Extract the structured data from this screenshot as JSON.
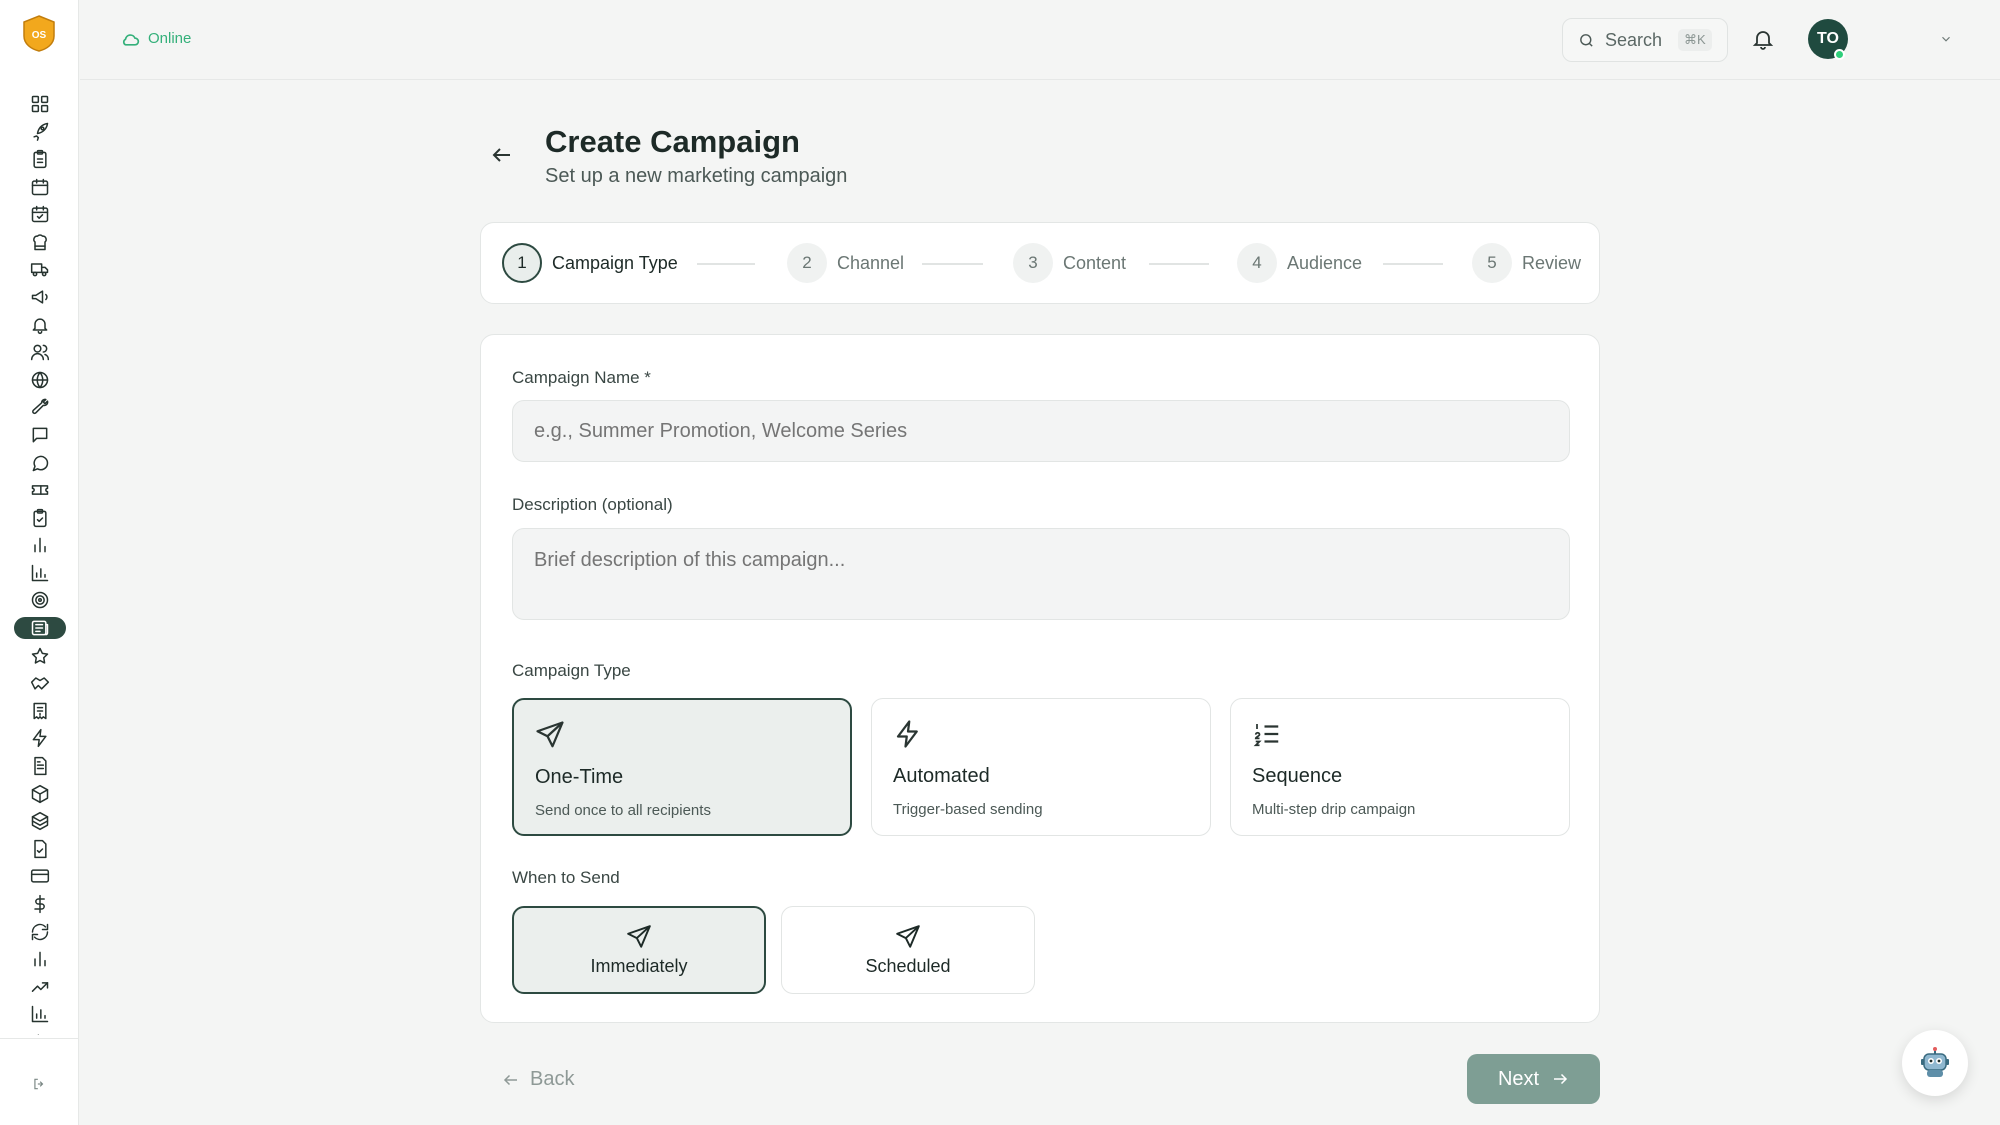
{
  "app": {
    "logo_text": "OS"
  },
  "topbar": {
    "status": "Online",
    "search_label": "Search",
    "search_shortcut": "⌘K",
    "avatar_initials": "TO"
  },
  "sidebar": {
    "nav_icons": [
      "grid-icon",
      "rocket-icon",
      "clipboard-icon",
      "calendar-icon",
      "calendar-check-icon",
      "chef-hat-icon",
      "truck-icon",
      "megaphone-icon",
      "bell-icon",
      "users-icon",
      "globe-icon",
      "wrench-icon",
      "message-square-icon",
      "message-circle-icon",
      "ticket-icon",
      "clipboard-check-icon",
      "bar-chart-icon",
      "bar-chart-axis-icon",
      "target-icon",
      "newspaper-icon",
      "star-icon",
      "handshake-icon",
      "receipt-icon",
      "zap-icon",
      "file-text-icon",
      "package-icon",
      "boxes-icon",
      "file-check-icon",
      "credit-card-icon",
      "dollar-icon",
      "refresh-icon",
      "bar-chart-icon",
      "trending-up-icon",
      "bar-chart-axis-icon",
      "activity-icon"
    ],
    "active_index": 19
  },
  "page": {
    "title": "Create Campaign",
    "subtitle": "Set up a new marketing campaign"
  },
  "steps": [
    {
      "num": "1",
      "label": "Campaign Type"
    },
    {
      "num": "2",
      "label": "Channel"
    },
    {
      "num": "3",
      "label": "Content"
    },
    {
      "num": "4",
      "label": "Audience"
    },
    {
      "num": "5",
      "label": "Review"
    }
  ],
  "form": {
    "name_label": "Campaign Name *",
    "name_placeholder": "e.g., Summer Promotion, Welcome Series",
    "name_value": "",
    "desc_label": "Description (optional)",
    "desc_placeholder": "Brief description of this campaign...",
    "desc_value": "",
    "type_label": "Campaign Type",
    "types": [
      {
        "title": "One-Time",
        "desc": "Send once to all recipients",
        "icon": "send-icon"
      },
      {
        "title": "Automated",
        "desc": "Trigger-based sending",
        "icon": "zap-icon"
      },
      {
        "title": "Sequence",
        "desc": "Multi-step drip campaign",
        "icon": "list-ordered-icon"
      }
    ],
    "selected_type": "One-Time",
    "when_label": "When to Send",
    "when_options": [
      {
        "label": "Immediately",
        "icon": "send-icon"
      },
      {
        "label": "Scheduled",
        "icon": "send-icon"
      }
    ],
    "selected_when": "Immediately"
  },
  "footer": {
    "back_label": "Back",
    "next_label": "Next"
  },
  "colors": {
    "accent": "#2d4a41",
    "online": "#34b07a",
    "next_bg": "#7e9e94"
  }
}
